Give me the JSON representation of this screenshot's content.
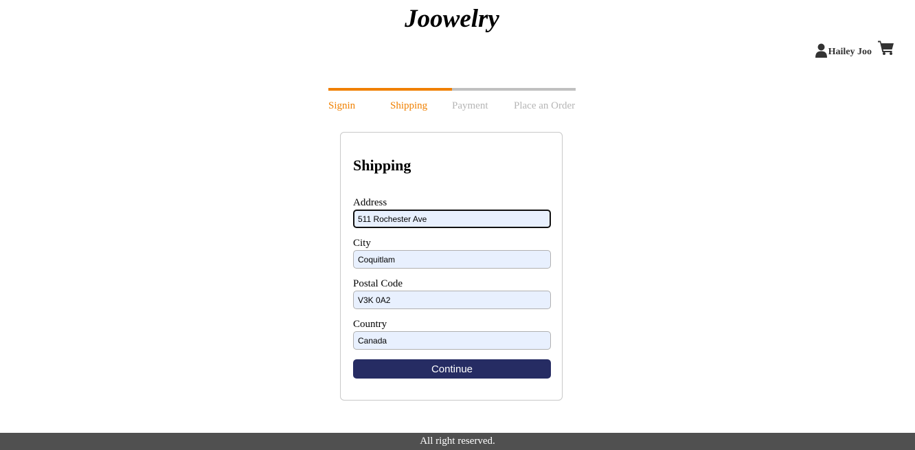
{
  "header": {
    "brand": "Joowelry",
    "user_name": "Hailey Joo",
    "user_icon": "user-icon",
    "cart_icon": "cart-icon"
  },
  "steps": [
    {
      "label": "Signin",
      "active": true
    },
    {
      "label": "Shipping",
      "active": true
    },
    {
      "label": "Payment",
      "active": false
    },
    {
      "label": "Place an Order",
      "active": false
    }
  ],
  "form": {
    "title": "Shipping",
    "address": {
      "label": "Address",
      "value": "511 Rochester Ave"
    },
    "city": {
      "label": "City",
      "value": "Coquitlam"
    },
    "postal_code": {
      "label": "Postal Code",
      "value": "V3K 0A2"
    },
    "country": {
      "label": "Country",
      "value": "Canada"
    },
    "continue_label": "Continue"
  },
  "footer": {
    "text": "All right reserved."
  },
  "colors": {
    "accent": "#f08000",
    "inactive_step": "#c0c0c0",
    "button": "#262c63",
    "input_bg": "#e8f0fe",
    "footer_bg": "#505050"
  }
}
